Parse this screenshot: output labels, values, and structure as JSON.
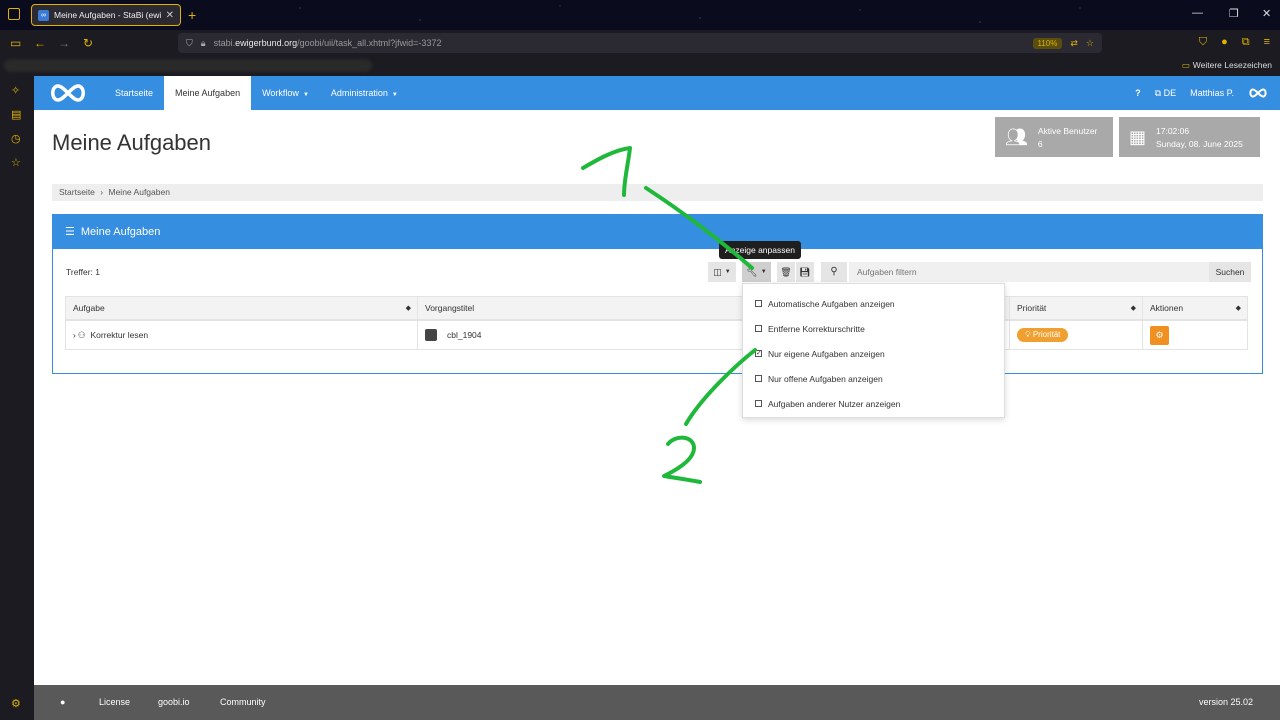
{
  "browser": {
    "tab_title": "Meine Aufgaben - StaBi (ewige",
    "new_tab": "+",
    "url_prefix": "stabi.",
    "url_domain": "ewigerbund.org",
    "url_path": "/goobi/uii/task_all.xhtml?jfwid=-3372",
    "zoom": "110%",
    "bookmarks_folder": "Weitere Lesezeichen"
  },
  "topnav": {
    "items": [
      {
        "label": "Startseite",
        "active": false
      },
      {
        "label": "Meine Aufgaben",
        "active": true
      },
      {
        "label": "Workflow",
        "active": false,
        "dropdown": true
      },
      {
        "label": "Administration",
        "active": false,
        "dropdown": true
      }
    ],
    "help": "?",
    "language": "DE",
    "user": "Matthias P."
  },
  "page_title": "Meine Aufgaben",
  "widgets": {
    "users_label": "Aktive Benutzer",
    "users_count": "6",
    "time": "17:02:06",
    "date": "Sunday, 08. June 2025"
  },
  "breadcrumb": {
    "home": "Startseite",
    "separator": "›",
    "current": "Meine Aufgaben"
  },
  "panel": {
    "title": "Meine Aufgaben",
    "hits": "Treffer: 1",
    "search_placeholder": "Aufgaben filtern",
    "search_button": "Suchen",
    "tooltip": "Anzeige anpassen"
  },
  "table": {
    "columns": [
      "Aufgabe",
      "Vorgangstitel",
      "Priorität",
      "Aktionen"
    ],
    "rows": [
      {
        "task": "Korrektur lesen",
        "process": "cbl_1904",
        "priority": "Priorität"
      }
    ]
  },
  "dropdown": {
    "items": [
      {
        "label": "Automatische Aufgaben anzeigen",
        "checked": false
      },
      {
        "label": "Entferne Korrekturschritte",
        "checked": false
      },
      {
        "label": "Nur eigene Aufgaben anzeigen",
        "checked": true
      },
      {
        "label": "Nur offene Aufgaben anzeigen",
        "checked": false
      },
      {
        "label": "Aufgaben anderer Nutzer anzeigen",
        "checked": false
      }
    ]
  },
  "annotations": {
    "one": "1",
    "two": "2",
    "color": "#1fb83a"
  },
  "footer": {
    "license": "License",
    "site": "goobi.io",
    "community": "Community",
    "version": "version 25.02"
  },
  "colors": {
    "primary": "#368ee0",
    "accent_orange": "#f09020",
    "firefox_accent": "#e0b300"
  }
}
